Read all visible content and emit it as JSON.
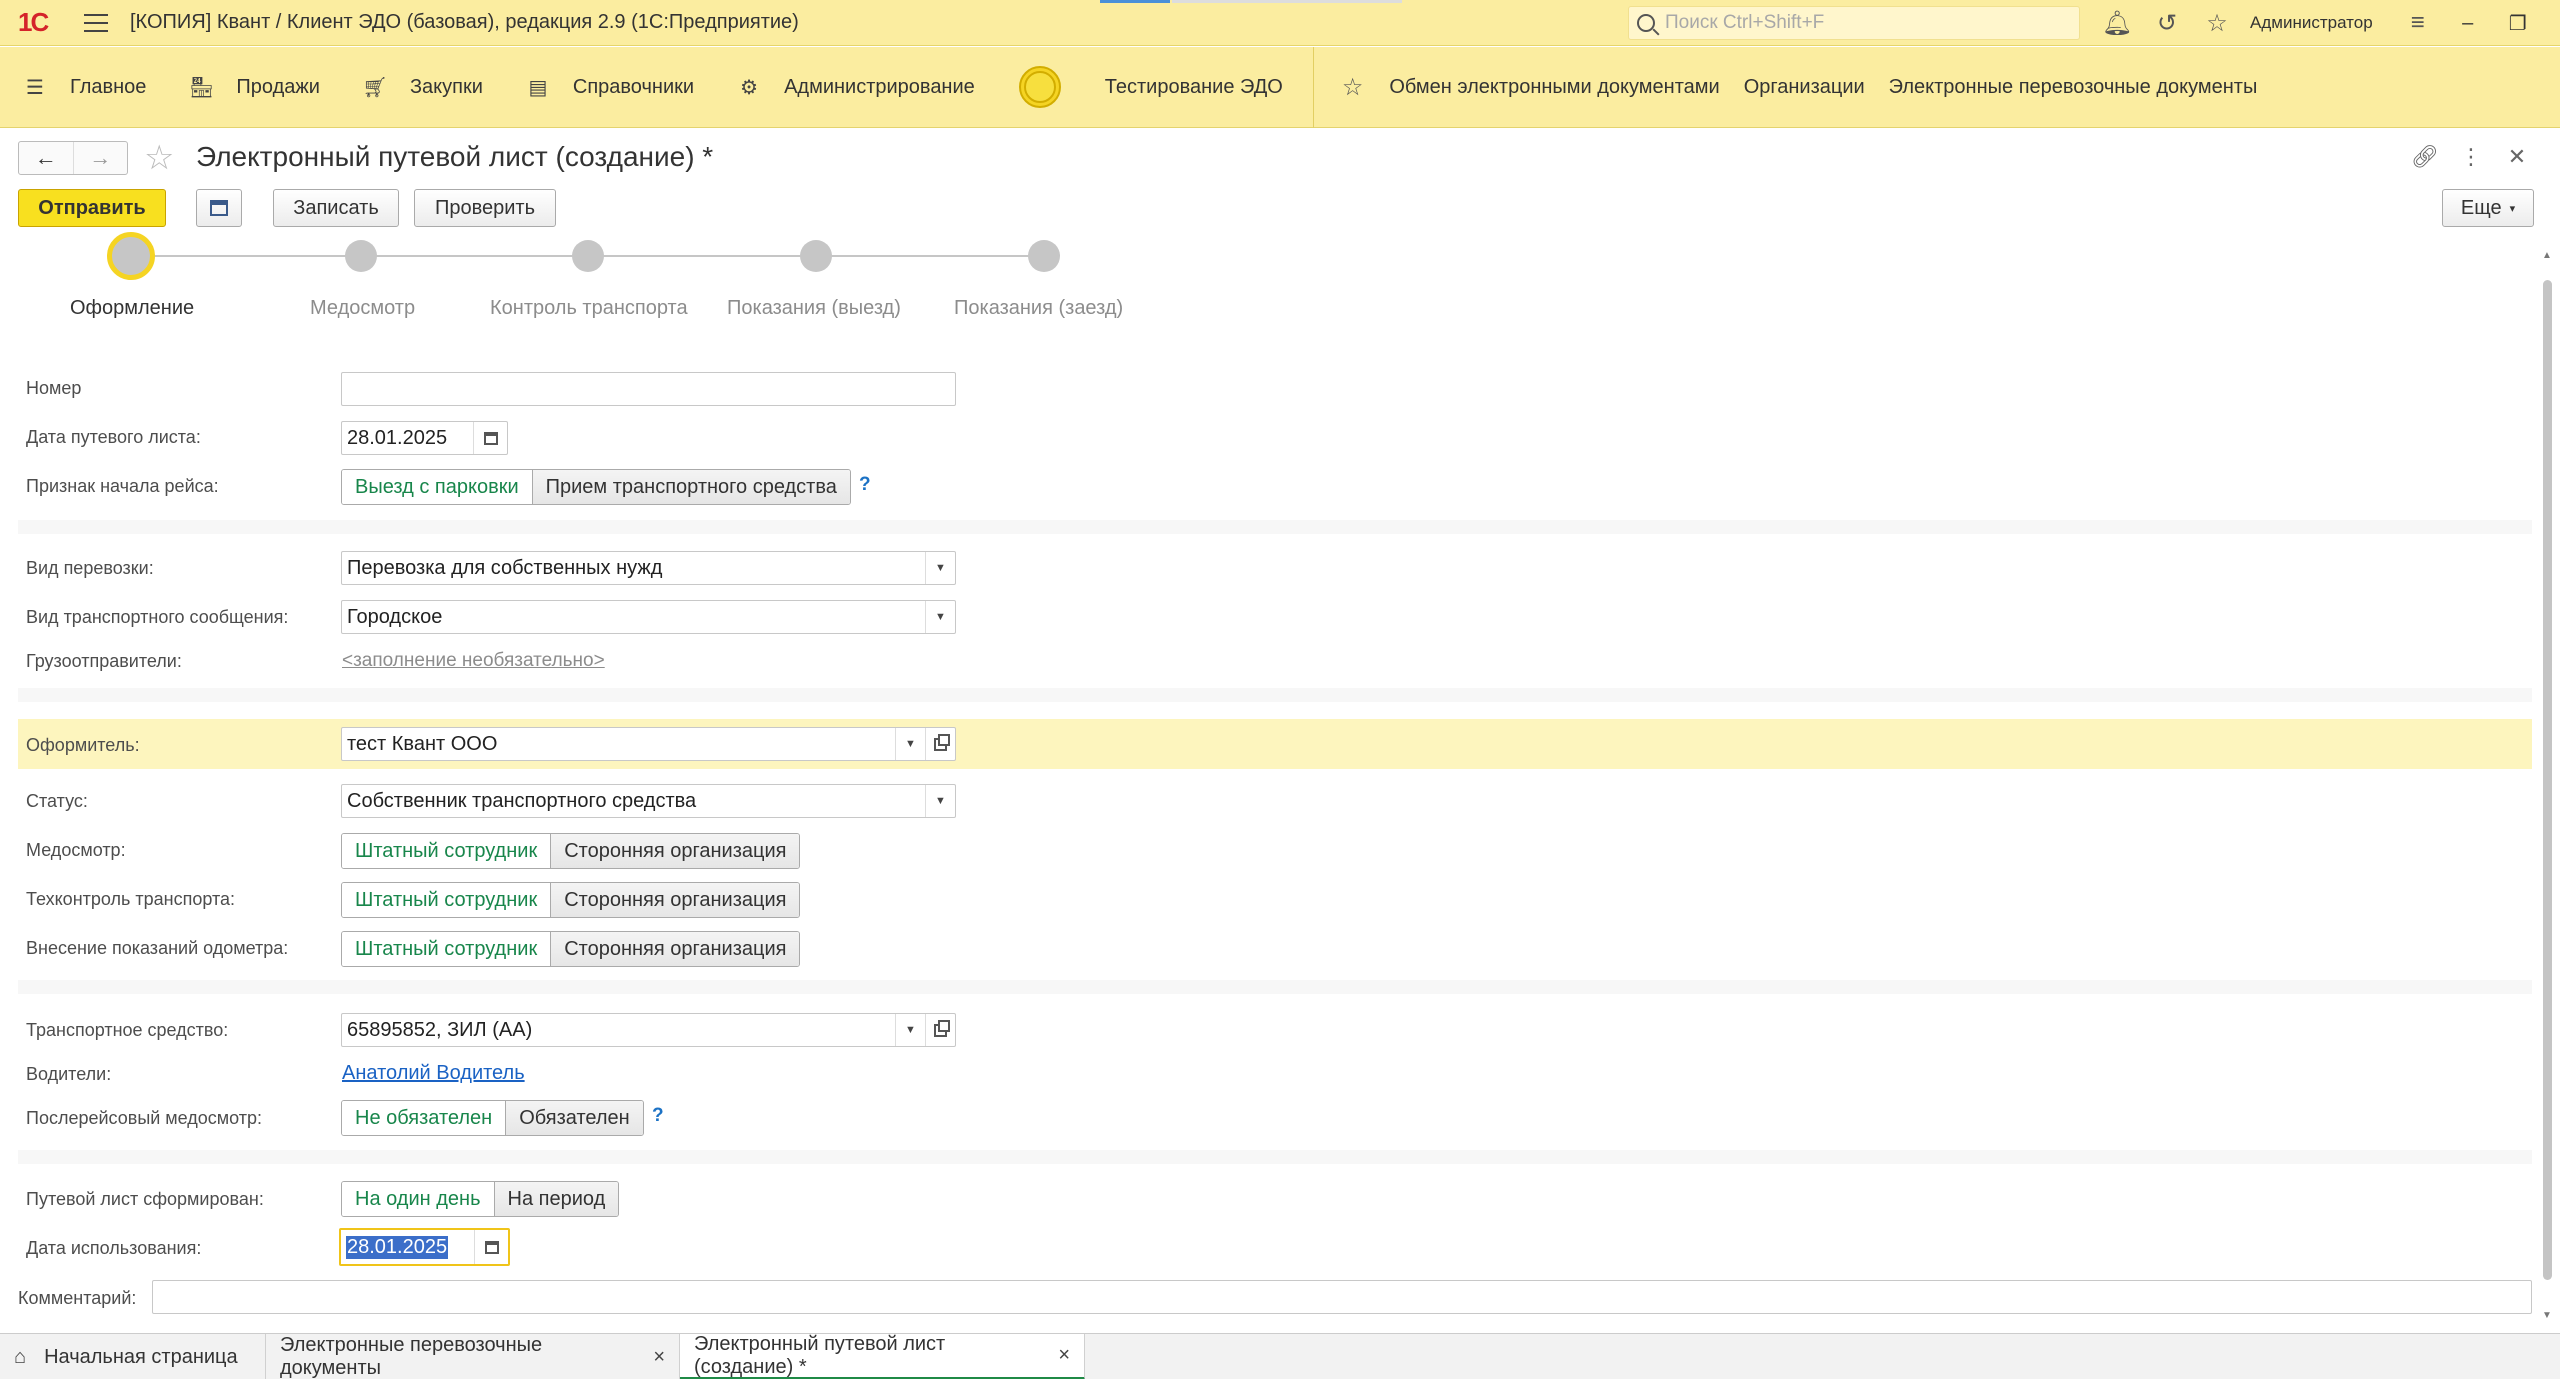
{
  "titlebar": {
    "logo": "1С",
    "title": "[КОПИЯ] Квант / Клиент ЭДО (базовая), редакция 2.9  (1С:Предприятие)",
    "search_placeholder": "Поиск Ctrl+Shift+F",
    "user": "Администратор"
  },
  "sections": [
    {
      "label": "Главное",
      "icon": "hamburger-icon"
    },
    {
      "label": "Продажи",
      "icon": "basket-icon"
    },
    {
      "label": "Закупки",
      "icon": "cart-icon"
    },
    {
      "label": "Справочники",
      "icon": "book-icon"
    },
    {
      "label": "Администрирование",
      "icon": "gear-icon"
    },
    {
      "label": "Тестирование ЭДО",
      "icon": "yellow-circle-icon"
    }
  ],
  "favorites": [
    "Обмен электронными документами",
    "Организации",
    "Электронные перевозочные документы"
  ],
  "form": {
    "title": "Электронный путевой лист (создание) *",
    "buttons": {
      "send": "Отправить",
      "save": "Записать",
      "check": "Проверить",
      "more": "Еще"
    }
  },
  "steps": [
    "Оформление",
    "Медосмотр",
    "Контроль транспорта",
    "Показания (выезд)",
    "Показания (заезд)"
  ],
  "fields": {
    "number_label": "Номер",
    "number_value": "",
    "date_label": "Дата путевого листа:",
    "date_value": "28.01.2025",
    "trip_start_label": "Признак начала рейса:",
    "trip_start_options": [
      "Выезд с парковки",
      "Прием транспортного средства"
    ],
    "help": "?",
    "transport_type_label": "Вид перевозки:",
    "transport_type_value": "Перевозка для собственных нужд",
    "connection_label": "Вид транспортного сообщения:",
    "connection_value": "Городское",
    "shippers_label": "Грузоотправители:",
    "shippers_value": "<заполнение необязательно>",
    "issuer_label": "Оформитель:",
    "issuer_value": "тест Квант ООО",
    "status_label": "Статус:",
    "status_value": "Собственник транспортного средства",
    "medcheck_label": "Медосмотр:",
    "techcheck_label": "Техконтроль транспорта:",
    "odometer_label": "Внесение показаний одометра:",
    "staff_options": [
      "Штатный сотрудник",
      "Сторонняя организация"
    ],
    "vehicle_label": "Транспортное средство:",
    "vehicle_value": "65895852, ЗИЛ  (АА)",
    "drivers_label": "Водители:",
    "drivers_value": "Анатолий Водитель",
    "post_medcheck_label": "Послерейсовый медосмотр:",
    "post_medcheck_options": [
      "Не обязателен",
      "Обязателен"
    ],
    "formed_label": "Путевой лист сформирован:",
    "formed_options": [
      "На один день",
      "На период"
    ],
    "usage_date_label": "Дата использования:",
    "usage_date_value": "28.01.2025",
    "comment_label": "Комментарий:",
    "comment_value": ""
  },
  "tabs": [
    {
      "label": "Начальная страница"
    },
    {
      "label": "Электронные перевозочные документы",
      "close": "×"
    },
    {
      "label": "Электронный путевой лист (создание) *",
      "close": "×"
    }
  ]
}
